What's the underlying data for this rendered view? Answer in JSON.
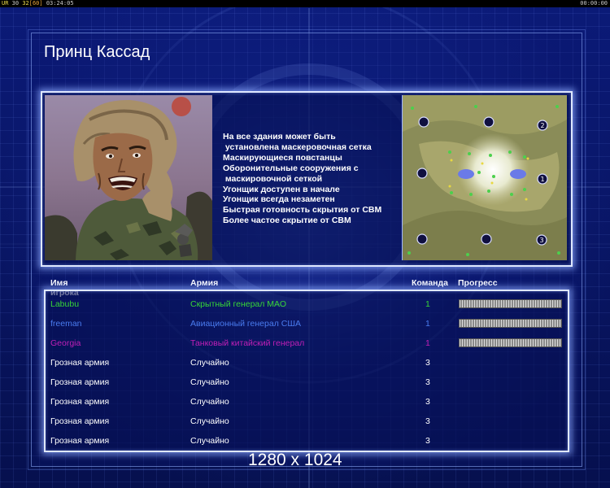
{
  "topbar": {
    "ur": "UR",
    "fps_a": "30",
    "fps_b": "32",
    "fps_c": "[60]",
    "clock": "03:24:05",
    "timer": "00:00:00"
  },
  "title": "Принц Кассад",
  "general_traits": [
    "На все здания может быть",
    " установлена маскеровочная сетка",
    "Маскирующиеся повстанцы",
    "Оборонительные сооружения с",
    " маскировочной сеткой",
    "Угонщик доступен в начале",
    "Угонщик всегда незаметен",
    "Быстрая готовность скрытия от СВМ",
    "Более частое скрытие от СВМ"
  ],
  "minimap": {
    "start_positions": [
      "2",
      "1",
      "3"
    ]
  },
  "table": {
    "headers": {
      "name": "Имя игрока",
      "army": "Армия",
      "team": "Команда",
      "progress": "Прогресс"
    },
    "rows": [
      {
        "name": "Labubu",
        "army": "Скрытный генерал МАО",
        "team": "1",
        "color": "#37d637",
        "progress": 1.0
      },
      {
        "name": "freeman",
        "army": "Авиационный генерал США",
        "team": "1",
        "color": "#4a7cf0",
        "progress": 1.0
      },
      {
        "name": "Georgia",
        "army": "Танковый китайский генерал",
        "team": "1",
        "color": "#c21fb6",
        "progress": 1.0
      },
      {
        "name": "Грозная армия",
        "army": "Случайно",
        "team": "3",
        "color": "#ffffff"
      },
      {
        "name": "Грозная армия",
        "army": "Случайно",
        "team": "3",
        "color": "#ffffff"
      },
      {
        "name": "Грозная армия",
        "army": "Случайно",
        "team": "3",
        "color": "#ffffff"
      },
      {
        "name": "Грозная армия",
        "army": "Случайно",
        "team": "3",
        "color": "#ffffff"
      },
      {
        "name": "Грозная армия",
        "army": "Случайно",
        "team": "3",
        "color": "#ffffff"
      }
    ]
  },
  "resolution": "1280 x 1024"
}
